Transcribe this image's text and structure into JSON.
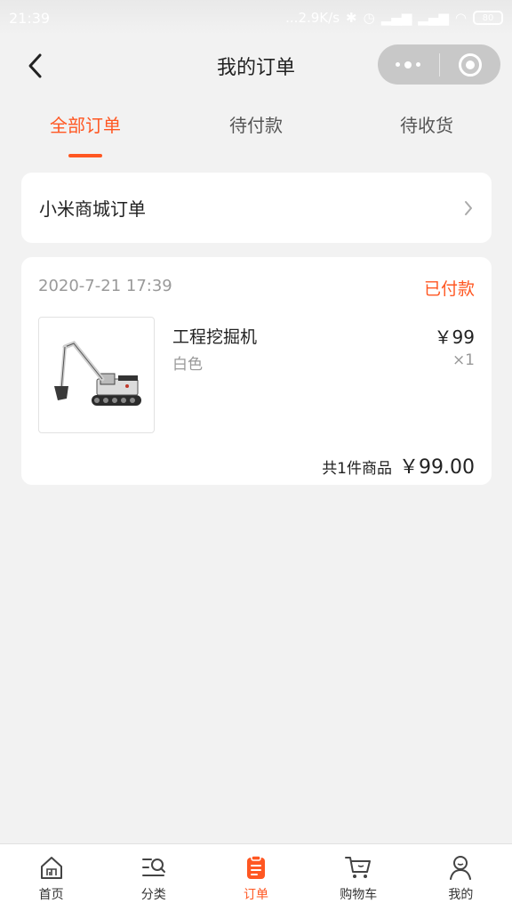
{
  "status_bar": {
    "time": "21:39",
    "network_speed": "...2.9K/s",
    "battery": "80"
  },
  "nav": {
    "title": "我的订单"
  },
  "tabs": [
    {
      "label": "全部订单",
      "active": true
    },
    {
      "label": "待付款",
      "active": false
    },
    {
      "label": "待收货",
      "active": false
    }
  ],
  "store_row": {
    "label": "小米商城订单"
  },
  "order": {
    "date": "2020-7-21 17:39",
    "status": "已付款",
    "product": {
      "name": "工程挖掘机",
      "variant": "白色",
      "price": "￥99",
      "quantity": "×1"
    },
    "summary": {
      "count_text": "共1件商品",
      "total": "￥99.00"
    }
  },
  "tab_bar": [
    {
      "label": "首页",
      "icon": "home-icon",
      "active": false
    },
    {
      "label": "分类",
      "icon": "category-search-icon",
      "active": false
    },
    {
      "label": "订单",
      "icon": "order-icon",
      "active": true
    },
    {
      "label": "购物车",
      "icon": "cart-icon",
      "active": false
    },
    {
      "label": "我的",
      "icon": "profile-icon",
      "active": false
    }
  ],
  "colors": {
    "accent": "#ff5722",
    "background": "#f2f2f2"
  }
}
